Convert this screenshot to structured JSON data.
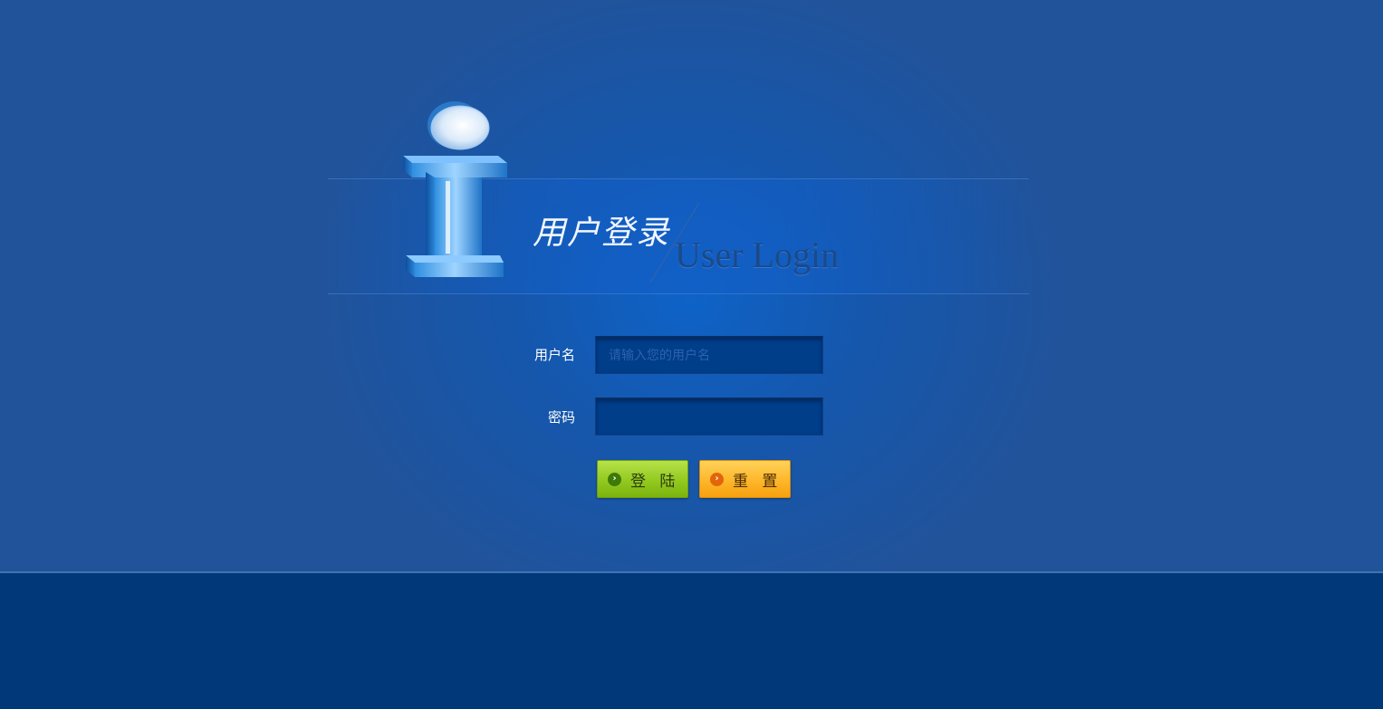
{
  "header": {
    "title_cn": "用户登录",
    "title_en": "User Login"
  },
  "form": {
    "username_label": "用户名",
    "username_placeholder": "请输入您的用户名",
    "username_value": "",
    "password_label": "密码",
    "password_value": ""
  },
  "buttons": {
    "login_label": "登 陆",
    "reset_label": "重 置"
  },
  "icons": {
    "logo": "info-i-icon",
    "login": "chevron-right-circle-icon",
    "reset": "chevron-right-circle-icon"
  },
  "colors": {
    "background_top": "#21539a",
    "background_center": "#0e63c8",
    "background_bottom": "#00387a",
    "input_bg": "#003e8a",
    "login_button": "#93c91f",
    "reset_button": "#fdb72a"
  }
}
